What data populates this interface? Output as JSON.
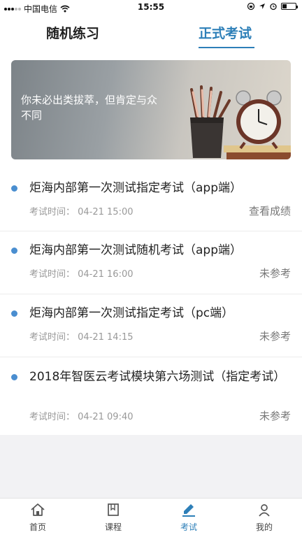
{
  "status_bar": {
    "carrier": "中国电信",
    "time": "15:55",
    "battery_level": 0.35
  },
  "tabs": [
    {
      "label": "随机练习",
      "active": false
    },
    {
      "label": "正式考试",
      "active": true
    }
  ],
  "banner": {
    "text": "你未必出类拔萃，但肯定与众不同"
  },
  "exams": [
    {
      "title": "炬海内部第一次测试指定考试（app端）",
      "meta": "考试时间： 04-21 15:00",
      "status": "查看成绩"
    },
    {
      "title": "炬海内部第一次测试随机考试（app端）",
      "meta": "考试时间： 04-21 16:00",
      "status": "未参考"
    },
    {
      "title": "炬海内部第一次测试指定考试（pc端）",
      "meta": "考试时间： 04-21 14:15",
      "status": "未参考"
    },
    {
      "title": "2018年智医云考试模块第六场测试（指定考试）",
      "meta": "考试时间： 04-21 09:40",
      "status": "未参考"
    }
  ],
  "bottom_nav": [
    {
      "label": "首页",
      "icon": "home-icon",
      "active": false
    },
    {
      "label": "课程",
      "icon": "book-icon",
      "active": false
    },
    {
      "label": "考试",
      "icon": "pen-icon",
      "active": true
    },
    {
      "label": "我的",
      "icon": "user-icon",
      "active": false
    }
  ],
  "colors": {
    "accent": "#2d7fb8",
    "dot": "#4a8ed0"
  }
}
